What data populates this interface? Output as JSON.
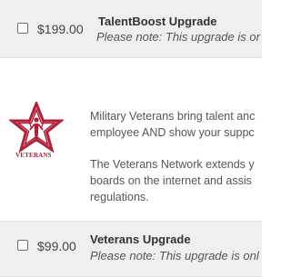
{
  "upgrades": [
    {
      "price": "$199.00",
      "title": "TalentBoost Upgrade",
      "note": "Please note: This upgrade is or"
    },
    {
      "price": "$99.00",
      "title": "Veterans Upgrade",
      "note": "Please note: This upgrade is onl"
    }
  ],
  "veterans": {
    "logo_text": "VETERANS",
    "brand_color": "#b01f3a",
    "paragraph1": [
      "Military Veterans bring talent anc",
      "employee AND show your suppc"
    ],
    "paragraph2": [
      "The Veterans Network extends y",
      "boards on the internet and assis",
      "regulations."
    ]
  }
}
